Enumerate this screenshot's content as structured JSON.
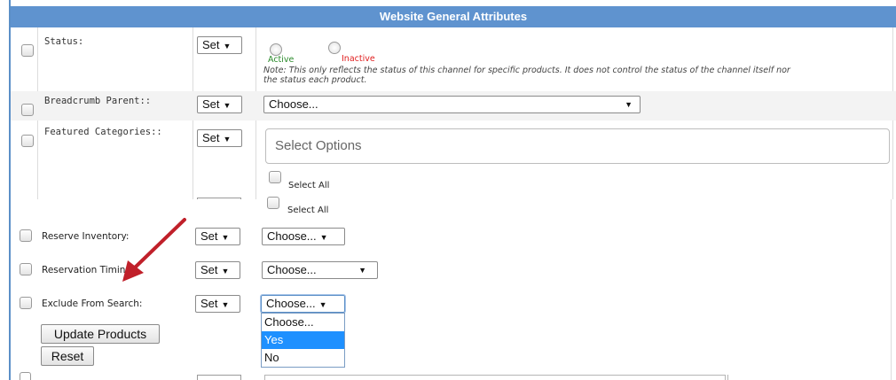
{
  "panel": {
    "title": "Website General Attributes"
  },
  "rows_back": {
    "status": {
      "label": "Status:",
      "set": "Set",
      "options": [
        "Active",
        "Inactive"
      ],
      "note_line1": "Note: This only reflects the status of this channel for specific products. It does not control the status of the channel itself nor",
      "note_line2": "the status each product."
    },
    "breadcrumb": {
      "label": "Breadcrumb Parent::",
      "set": "Set",
      "value": "Choose..."
    },
    "featured": {
      "label": "Featured Categories::",
      "set": "Set",
      "placeholder": "Select Options",
      "select_all": "Select All"
    }
  },
  "rows_front": {
    "select_all": "Select All",
    "reserve": {
      "label": "Reserve Inventory:",
      "set": "Set",
      "value": "Choose..."
    },
    "timing": {
      "label": "Reservation Timing",
      "set": "Set",
      "value": "Choose..."
    },
    "exclude": {
      "label": "Exclude From Search:",
      "set": "Set",
      "value": "Choose...",
      "options": [
        "Choose...",
        "Yes",
        "No"
      ],
      "highlighted": "Yes"
    }
  },
  "buttons": {
    "update": "Update Products",
    "reset": "Reset"
  },
  "colors": {
    "header": "#5f93cf",
    "active": "#2a8a2a",
    "inactive": "#e02020",
    "highlight": "#1e90ff",
    "arrow": "#c0202a"
  },
  "icons": {
    "dropdown": "triangle-down",
    "annotation": "red-arrow"
  }
}
